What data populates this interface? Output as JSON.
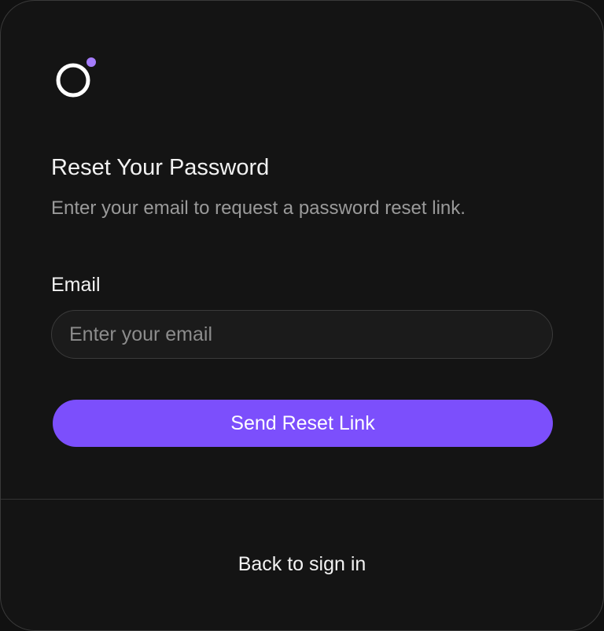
{
  "brand": {
    "logo_icon": "ring-with-dot-logo",
    "accent_color": "#7c4ffc",
    "dot_color": "#a57cfc"
  },
  "reset": {
    "title": "Reset Your Password",
    "subtitle": "Enter your email to request a password reset link."
  },
  "email": {
    "label": "Email",
    "placeholder": "Enter your email",
    "value": ""
  },
  "actions": {
    "send_label": "Send Reset Link",
    "back_label": "Back to sign in"
  },
  "colors": {
    "background": "#141414",
    "text_primary": "#f2f2f2",
    "text_secondary": "#9a9a9a",
    "input_background": "#1b1b1b",
    "border": "#3a3a3a"
  }
}
